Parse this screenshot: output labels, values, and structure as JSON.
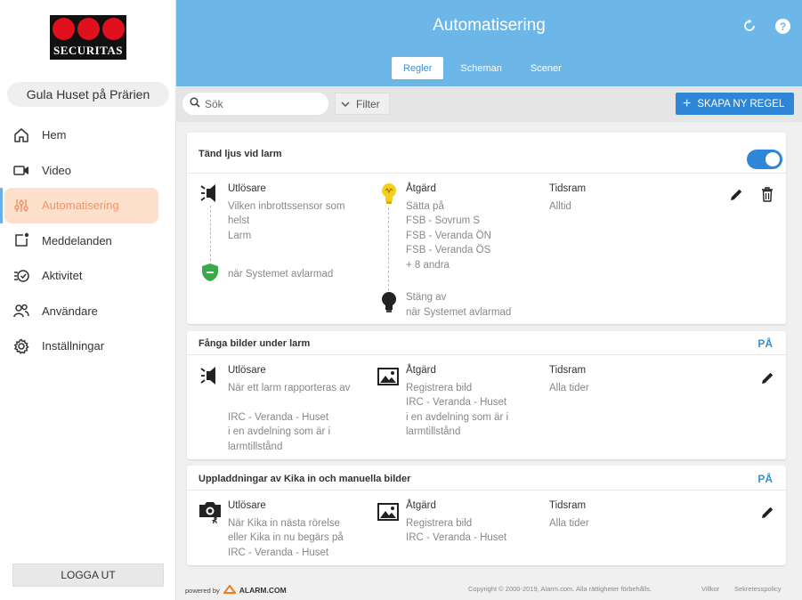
{
  "brand": {
    "logo_text": "SECURITAS"
  },
  "site_name": "Gula Huset på Prärien",
  "nav": [
    {
      "label": "Hem",
      "icon": "home-icon"
    },
    {
      "label": "Video",
      "icon": "video-camera-icon"
    },
    {
      "label": "Automatisering",
      "icon": "sliders-icon",
      "active": true
    },
    {
      "label": "Meddelanden",
      "icon": "message-icon"
    },
    {
      "label": "Aktivitet",
      "icon": "activity-icon"
    },
    {
      "label": "Användare",
      "icon": "users-icon"
    },
    {
      "label": "Inställningar",
      "icon": "gear-icon"
    }
  ],
  "logout_label": "LOGGA UT",
  "header": {
    "title": "Automatisering"
  },
  "tabs": [
    {
      "label": "Regler",
      "active": true
    },
    {
      "label": "Scheman"
    },
    {
      "label": "Scener"
    }
  ],
  "toolbar": {
    "search_placeholder": "Sök",
    "filter_label": "Filter",
    "create_label": "SKAPA NY REGEL"
  },
  "rules": [
    {
      "title": "Tänd ljus vid larm",
      "enabled": true,
      "trigger_heading": "Utlösare",
      "trigger_lines": [
        "Vilken inbrottssensor som",
        "helst",
        "Larm"
      ],
      "condition": "när Systemet avlarmad",
      "action_heading": "Åtgärd",
      "action_lines": [
        "Sätta på",
        "FSB - Sovrum S",
        "FSB - Veranda ÖN",
        "FSB - Veranda ÖS",
        " + 8 andra"
      ],
      "action2_lines": [
        "Stäng av",
        "när Systemet avlarmad"
      ],
      "time_heading": "Tidsram",
      "time_value": "Alltid"
    },
    {
      "title": "Fånga bilder under larm",
      "status": "PÅ",
      "trigger_heading": "Utlösare",
      "trigger_lines": [
        "När ett larm rapporteras av",
        "",
        "IRC - Veranda - Huset",
        " i en avdelning som är i",
        "larmtillstånd"
      ],
      "action_heading": "Åtgärd",
      "action_lines": [
        "Registrera bild",
        "IRC - Veranda - Huset",
        " i en avdelning som är i",
        "larmtillstånd"
      ],
      "time_heading": "Tidsram",
      "time_value": "Alla tider"
    },
    {
      "title": "Uppladdningar av Kika in och manuella bilder",
      "status": "PÅ",
      "trigger_heading": "Utlösare",
      "trigger_lines": [
        "När Kika in nästa rörelse",
        "eller Kika in nu begärs på",
        "IRC - Veranda - Huset"
      ],
      "action_heading": "Åtgärd",
      "action_lines": [
        "Registrera bild",
        "IRC - Veranda - Huset"
      ],
      "time_heading": "Tidsram",
      "time_value": "Alla tider"
    }
  ],
  "footer": {
    "powered_by": "powered by",
    "powered_brand": "ALARM.COM",
    "copyright": "Copyright © 2000-2019, Alarm.com. Alla rättigheter förbehålls.",
    "villkor": "Villkor",
    "sekretess": "Sekretesspolicy"
  },
  "colors": {
    "header": "#6db7e8",
    "accent": "#2f86d6",
    "active_nav_bg": "#fde0cc",
    "active_nav_text": "#f0956a"
  }
}
